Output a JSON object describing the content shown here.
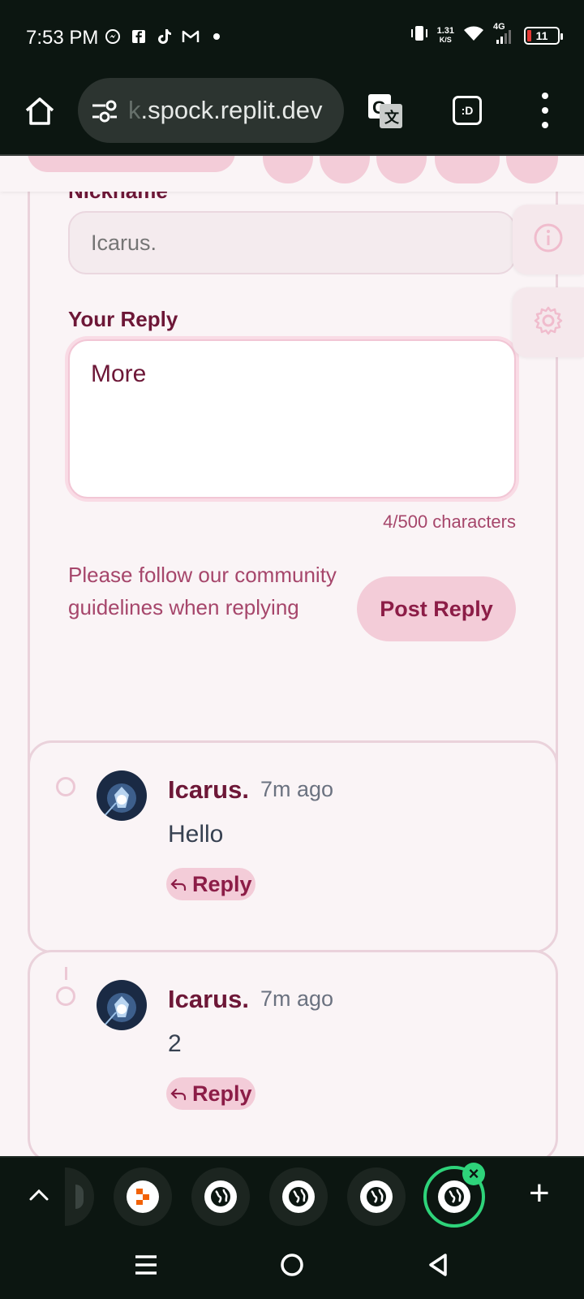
{
  "status_bar": {
    "time": "7:53 PM",
    "net_speed_value": "1.31",
    "net_speed_unit": "K/S",
    "network": "4G",
    "battery": "11"
  },
  "browser": {
    "url_fade": "k",
    "url": ".spock.replit.dev",
    "tabs_label": ":D"
  },
  "reply_form": {
    "nickname_label": "Nickname",
    "nickname_placeholder": "Icarus.",
    "reply_label": "Your Reply",
    "reply_value": "More",
    "char_count": "4/500 characters",
    "guidelines": "Please follow our community guidelines when replying",
    "post_button": "Post Reply"
  },
  "comments": [
    {
      "author": "Icarus.",
      "time": "7m ago",
      "text": "Hello",
      "reply_label": "Reply"
    },
    {
      "author": "Icarus.",
      "time": "7m ago",
      "text": "2",
      "reply_label": "Reply"
    }
  ],
  "colors": {
    "accent": "#8c1d47",
    "pink_chip": "#f3ccd8",
    "background": "#faf4f6",
    "active_tab": "#2ed37a"
  }
}
